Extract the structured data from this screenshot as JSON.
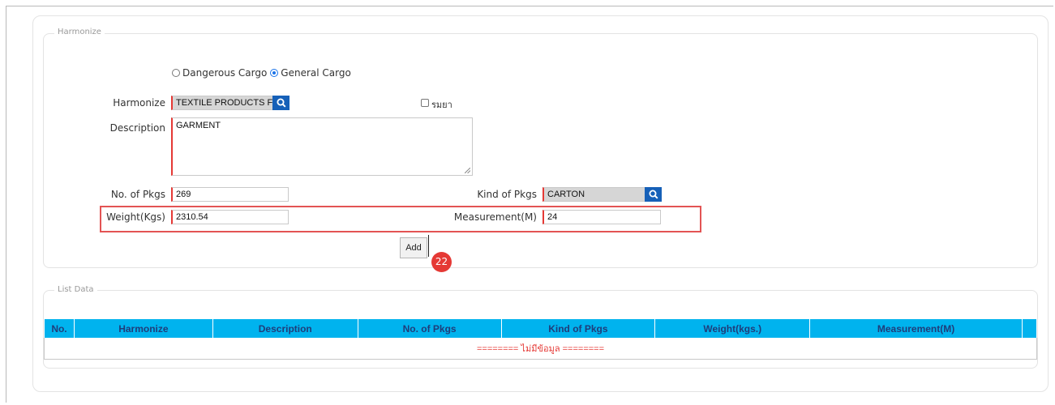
{
  "harmonize_section": {
    "legend": "Harmonize",
    "cargo_type": {
      "options": [
        "Dangerous Cargo",
        "General Cargo"
      ],
      "selected": "General Cargo"
    },
    "harmonize_label": "Harmonize",
    "harmonize_value": "TEXTILE PRODUCTS F",
    "medicine_checkbox_label": "รมยา",
    "description_label": "Description",
    "description_value": "GARMENT",
    "no_of_pkgs_label": "No. of Pkgs",
    "no_of_pkgs_value": "269",
    "kind_of_pkgs_label": "Kind of Pkgs",
    "kind_of_pkgs_value": "CARTON",
    "weight_label": "Weight(Kgs)",
    "weight_value": "2310.54",
    "measurement_label": "Measurement(M)",
    "measurement_value": "24",
    "add_button_label": "Add",
    "step_badge": "22"
  },
  "list_section": {
    "legend": "List Data",
    "columns": [
      "No.",
      "Harmonize",
      "Description",
      "No. of Pkgs",
      "Kind of Pkgs",
      "Weight(kgs.)",
      "Measurement(M)"
    ],
    "empty_message": "======== ไม่มีข้อมูล ========"
  },
  "colors": {
    "table_header_bg": "#00b3ee",
    "required_marker": "#e53935",
    "search_button": "#1660b8",
    "highlight_box": "#e35454",
    "step_badge": "#e53935"
  }
}
